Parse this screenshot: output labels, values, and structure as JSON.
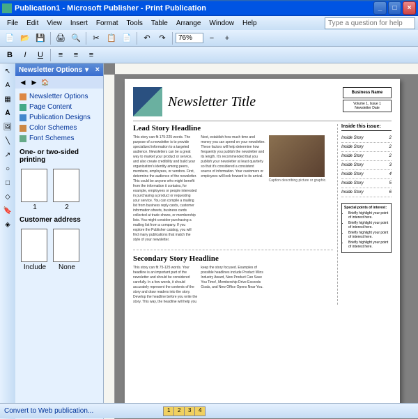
{
  "window": {
    "title": "Publication1 - Microsoft Publisher - Print Publication"
  },
  "menus": [
    "File",
    "Edit",
    "View",
    "Insert",
    "Format",
    "Tools",
    "Table",
    "Arrange",
    "Window",
    "Help"
  ],
  "helpPrompt": "Type a question for help",
  "zoom": "76%",
  "taskpane": {
    "title": "Newsletter Options",
    "items": [
      "Newsletter Options",
      "Page Content",
      "Publication Designs",
      "Color Schemes",
      "Font Schemes"
    ],
    "printing": {
      "label": "One- or two-sided printing",
      "opt1": "1",
      "opt2": "2"
    },
    "address": {
      "label": "Customer address",
      "opt1": "Include",
      "opt2": "None"
    }
  },
  "newsletter": {
    "title": "Newsletter Title",
    "businessName": "Business Name",
    "volume": "Volume 1, Issue 1",
    "date": "Newsletter Date",
    "lead": {
      "headline": "Lead Story Headline",
      "col1": "This story can fit 175-225 words. The purpose of a newsletter is to provide specialized information to a targeted audience. Newsletters can be a great way to market your product or service, and also create credibility and build your organization's identity among peers, members, employees, or vendors. First, determine the audience of the newsletter. This could be anyone who might benefit from the information it contains, for example, employees or people interested in purchasing a product or requesting your service. You can compile a mailing list from business reply cards, customer information sheets, business cards collected at trade shows, or membership lists. You might consider purchasing a mailing list from a company. If you explore the Publisher catalog, you will find many publications that match the style of your newsletter.",
      "col2": "Next, establish how much time and money you can spend on your newsletter. These factors will help determine how frequently you publish the newsletter and its length. It's recommended that you publish your newsletter at least quarterly so that it's considered a consistent source of information. Your customers or employees will look forward to its arrival.",
      "caption": "Caption describing picture or graphic."
    },
    "secondary": {
      "headline": "Secondary Story Headline",
      "col1": "This story can fit 75-125 words. Your headline is an important part of the newsletter and should be considered carefully. In a few words, it should accurately represent the contents of the story and draw readers into the story. Develop the headline before you write the story. This way, the headline will help you",
      "col2": "keep the story focused. Examples of possible headlines include Product Wins Industry Award, New Product Can Save You Time!, Membership Drive Exceeds Goals, and New Office Opens Near You."
    },
    "toc": {
      "header": "Inside this issue:",
      "items": [
        {
          "t": "Inside Story",
          "p": "2"
        },
        {
          "t": "Inside Story",
          "p": "2"
        },
        {
          "t": "Inside Story",
          "p": "2"
        },
        {
          "t": "Inside Story",
          "p": "3"
        },
        {
          "t": "Inside Story",
          "p": "4"
        },
        {
          "t": "Inside Story",
          "p": "5"
        },
        {
          "t": "Inside Story",
          "p": "6"
        }
      ]
    },
    "special": {
      "header": "Special points of interest:",
      "items": [
        "Briefly highlight your point of interest here.",
        "Briefly highlight your point of interest here.",
        "Briefly highlight your point of interest here.",
        "Briefly highlight your point of interest here."
      ]
    }
  },
  "status": {
    "webLink": "Convert to Web publication...",
    "pages": [
      "1",
      "2",
      "3",
      "4"
    ]
  }
}
